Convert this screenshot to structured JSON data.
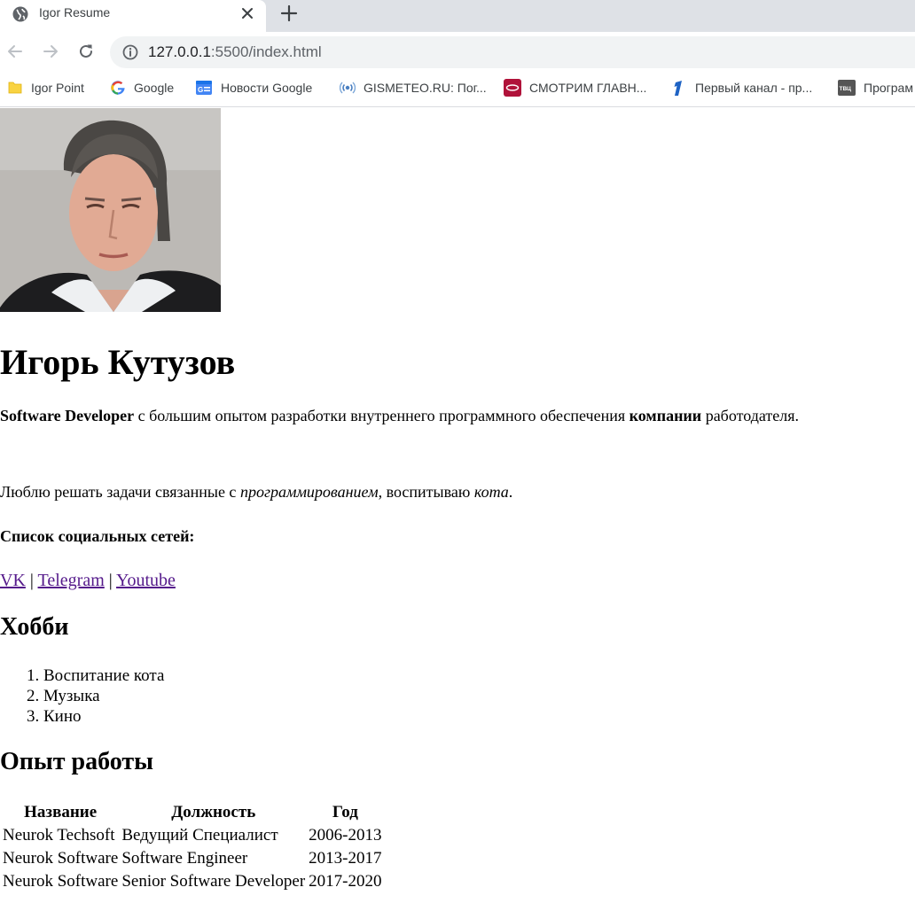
{
  "browser": {
    "tab_title": "Igor Resume",
    "url_host": "127.0.0.1",
    "url_rest": ":5500/index.html"
  },
  "bookmarks": [
    {
      "label": "Igor Point",
      "icon": "folder-icon"
    },
    {
      "label": "Google",
      "icon": "google-icon"
    },
    {
      "label": "Новости Google",
      "icon": "google-news-icon"
    },
    {
      "label": "GISMETEO.RU: Пог...",
      "icon": "gismeteo-icon"
    },
    {
      "label": "СМОТРИМ ГЛАВН...",
      "icon": "smotrim-icon"
    },
    {
      "label": "Первый канал - пр...",
      "icon": "channel-one-icon"
    },
    {
      "label": "Програм",
      "icon": "tvc-icon"
    }
  ],
  "page": {
    "name": "Игорь Кутузов",
    "intro": {
      "strong1": "Software Developer",
      "text1": " с большим опытом разработки внутреннего программного обеспечения ",
      "strong2": "компании",
      "text2": " работодателя."
    },
    "love": {
      "text1": "Люблю решать задачи связанные с ",
      "em1": "программированием",
      "text2": ", воспитываю ",
      "em2": "кота",
      "text3": "."
    },
    "social_title": "Список социальных сетей:",
    "social_links": [
      "VK",
      "Telegram",
      "Youtube"
    ],
    "separator": " | ",
    "hobby_title": "Хобби",
    "hobbies": [
      "Воспитание кота",
      "Музыка",
      "Кино"
    ],
    "work_title": "Опыт работы",
    "work_headers": [
      "Название",
      "Должность",
      "Год"
    ],
    "work_rows": [
      [
        "Neurok Techsoft",
        "Ведущий Специалист",
        "2006-2013"
      ],
      [
        "Neurok Software",
        "Software Engineer",
        "2013-2017"
      ],
      [
        "Neurok Software",
        "Senior Software Developer",
        "2017-2020"
      ]
    ]
  },
  "colors": {
    "tabbar_bg": "#dee1e6",
    "omnibox_bg": "#f1f3f4",
    "visited_link": "#551a8b"
  }
}
